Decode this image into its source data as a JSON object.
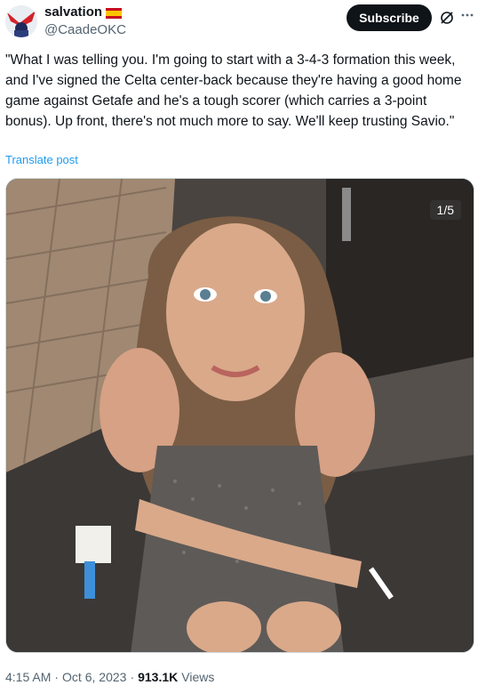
{
  "header": {
    "display_name": "salvation",
    "handle": "@CaadeOKC",
    "subscribe_label": "Subscribe",
    "flag_icon": "spain-flag-icon",
    "grok_icon": "grok-icon",
    "more_icon": "more-icon"
  },
  "tweet": {
    "text": "\"What I was telling you. I'm going to start with a 3-4-3 formation this week, and I've signed the Celta center-back because they're having a good home game against Getafe and he's a tough scorer (which carries a 3-point bonus). Up front, there's not much more to say. We'll keep trusting Savio.\"",
    "translate_label": "Translate post"
  },
  "media": {
    "counter": "1/5"
  },
  "footer": {
    "time": "4:15 AM",
    "sep1": "·",
    "date": "Oct 6, 2023",
    "sep2": "·",
    "views_count": "913.1K",
    "views_label": "Views"
  },
  "colors": {
    "accent": "#1d9bf0",
    "text": "#0f1419",
    "muted": "#536471"
  }
}
